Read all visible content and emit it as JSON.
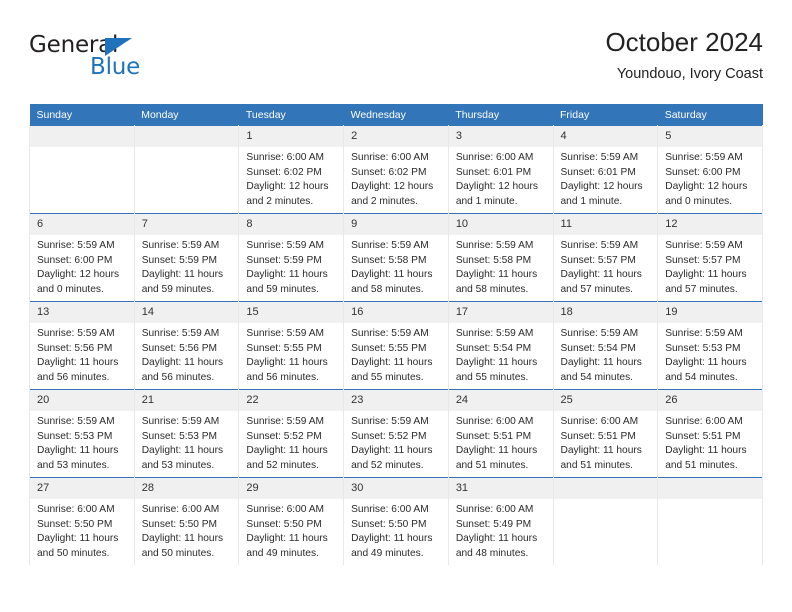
{
  "brand": {
    "name_top": "General",
    "name_bottom": "Blue",
    "triangle_icon": "blue-triangle-icon",
    "color_black": "#231f20",
    "color_blue": "#1f73bd"
  },
  "header": {
    "title": "October 2024",
    "subtitle": "Youndouo, Ivory Coast"
  },
  "theme": {
    "header_blue": "#3275b9",
    "daynum_gray": "#f0f0f0",
    "cell_border": "#e8e8e8"
  },
  "weekday_headers": [
    "Sunday",
    "Monday",
    "Tuesday",
    "Wednesday",
    "Thursday",
    "Friday",
    "Saturday"
  ],
  "weeks": [
    [
      {
        "day": "",
        "empty": true,
        "sunrise": "",
        "sunset": "",
        "daylight_1": "",
        "daylight_2": ""
      },
      {
        "day": "",
        "empty": true,
        "sunrise": "",
        "sunset": "",
        "daylight_1": "",
        "daylight_2": ""
      },
      {
        "day": "1",
        "empty": false,
        "sunrise": "Sunrise: 6:00 AM",
        "sunset": "Sunset: 6:02 PM",
        "daylight_1": "Daylight: 12 hours",
        "daylight_2": "and 2 minutes."
      },
      {
        "day": "2",
        "empty": false,
        "sunrise": "Sunrise: 6:00 AM",
        "sunset": "Sunset: 6:02 PM",
        "daylight_1": "Daylight: 12 hours",
        "daylight_2": "and 2 minutes."
      },
      {
        "day": "3",
        "empty": false,
        "sunrise": "Sunrise: 6:00 AM",
        "sunset": "Sunset: 6:01 PM",
        "daylight_1": "Daylight: 12 hours",
        "daylight_2": "and 1 minute."
      },
      {
        "day": "4",
        "empty": false,
        "sunrise": "Sunrise: 5:59 AM",
        "sunset": "Sunset: 6:01 PM",
        "daylight_1": "Daylight: 12 hours",
        "daylight_2": "and 1 minute."
      },
      {
        "day": "5",
        "empty": false,
        "sunrise": "Sunrise: 5:59 AM",
        "sunset": "Sunset: 6:00 PM",
        "daylight_1": "Daylight: 12 hours",
        "daylight_2": "and 0 minutes."
      }
    ],
    [
      {
        "day": "6",
        "empty": false,
        "sunrise": "Sunrise: 5:59 AM",
        "sunset": "Sunset: 6:00 PM",
        "daylight_1": "Daylight: 12 hours",
        "daylight_2": "and 0 minutes."
      },
      {
        "day": "7",
        "empty": false,
        "sunrise": "Sunrise: 5:59 AM",
        "sunset": "Sunset: 5:59 PM",
        "daylight_1": "Daylight: 11 hours",
        "daylight_2": "and 59 minutes."
      },
      {
        "day": "8",
        "empty": false,
        "sunrise": "Sunrise: 5:59 AM",
        "sunset": "Sunset: 5:59 PM",
        "daylight_1": "Daylight: 11 hours",
        "daylight_2": "and 59 minutes."
      },
      {
        "day": "9",
        "empty": false,
        "sunrise": "Sunrise: 5:59 AM",
        "sunset": "Sunset: 5:58 PM",
        "daylight_1": "Daylight: 11 hours",
        "daylight_2": "and 58 minutes."
      },
      {
        "day": "10",
        "empty": false,
        "sunrise": "Sunrise: 5:59 AM",
        "sunset": "Sunset: 5:58 PM",
        "daylight_1": "Daylight: 11 hours",
        "daylight_2": "and 58 minutes."
      },
      {
        "day": "11",
        "empty": false,
        "sunrise": "Sunrise: 5:59 AM",
        "sunset": "Sunset: 5:57 PM",
        "daylight_1": "Daylight: 11 hours",
        "daylight_2": "and 57 minutes."
      },
      {
        "day": "12",
        "empty": false,
        "sunrise": "Sunrise: 5:59 AM",
        "sunset": "Sunset: 5:57 PM",
        "daylight_1": "Daylight: 11 hours",
        "daylight_2": "and 57 minutes."
      }
    ],
    [
      {
        "day": "13",
        "empty": false,
        "sunrise": "Sunrise: 5:59 AM",
        "sunset": "Sunset: 5:56 PM",
        "daylight_1": "Daylight: 11 hours",
        "daylight_2": "and 56 minutes."
      },
      {
        "day": "14",
        "empty": false,
        "sunrise": "Sunrise: 5:59 AM",
        "sunset": "Sunset: 5:56 PM",
        "daylight_1": "Daylight: 11 hours",
        "daylight_2": "and 56 minutes."
      },
      {
        "day": "15",
        "empty": false,
        "sunrise": "Sunrise: 5:59 AM",
        "sunset": "Sunset: 5:55 PM",
        "daylight_1": "Daylight: 11 hours",
        "daylight_2": "and 56 minutes."
      },
      {
        "day": "16",
        "empty": false,
        "sunrise": "Sunrise: 5:59 AM",
        "sunset": "Sunset: 5:55 PM",
        "daylight_1": "Daylight: 11 hours",
        "daylight_2": "and 55 minutes."
      },
      {
        "day": "17",
        "empty": false,
        "sunrise": "Sunrise: 5:59 AM",
        "sunset": "Sunset: 5:54 PM",
        "daylight_1": "Daylight: 11 hours",
        "daylight_2": "and 55 minutes."
      },
      {
        "day": "18",
        "empty": false,
        "sunrise": "Sunrise: 5:59 AM",
        "sunset": "Sunset: 5:54 PM",
        "daylight_1": "Daylight: 11 hours",
        "daylight_2": "and 54 minutes."
      },
      {
        "day": "19",
        "empty": false,
        "sunrise": "Sunrise: 5:59 AM",
        "sunset": "Sunset: 5:53 PM",
        "daylight_1": "Daylight: 11 hours",
        "daylight_2": "and 54 minutes."
      }
    ],
    [
      {
        "day": "20",
        "empty": false,
        "sunrise": "Sunrise: 5:59 AM",
        "sunset": "Sunset: 5:53 PM",
        "daylight_1": "Daylight: 11 hours",
        "daylight_2": "and 53 minutes."
      },
      {
        "day": "21",
        "empty": false,
        "sunrise": "Sunrise: 5:59 AM",
        "sunset": "Sunset: 5:53 PM",
        "daylight_1": "Daylight: 11 hours",
        "daylight_2": "and 53 minutes."
      },
      {
        "day": "22",
        "empty": false,
        "sunrise": "Sunrise: 5:59 AM",
        "sunset": "Sunset: 5:52 PM",
        "daylight_1": "Daylight: 11 hours",
        "daylight_2": "and 52 minutes."
      },
      {
        "day": "23",
        "empty": false,
        "sunrise": "Sunrise: 5:59 AM",
        "sunset": "Sunset: 5:52 PM",
        "daylight_1": "Daylight: 11 hours",
        "daylight_2": "and 52 minutes."
      },
      {
        "day": "24",
        "empty": false,
        "sunrise": "Sunrise: 6:00 AM",
        "sunset": "Sunset: 5:51 PM",
        "daylight_1": "Daylight: 11 hours",
        "daylight_2": "and 51 minutes."
      },
      {
        "day": "25",
        "empty": false,
        "sunrise": "Sunrise: 6:00 AM",
        "sunset": "Sunset: 5:51 PM",
        "daylight_1": "Daylight: 11 hours",
        "daylight_2": "and 51 minutes."
      },
      {
        "day": "26",
        "empty": false,
        "sunrise": "Sunrise: 6:00 AM",
        "sunset": "Sunset: 5:51 PM",
        "daylight_1": "Daylight: 11 hours",
        "daylight_2": "and 51 minutes."
      }
    ],
    [
      {
        "day": "27",
        "empty": false,
        "sunrise": "Sunrise: 6:00 AM",
        "sunset": "Sunset: 5:50 PM",
        "daylight_1": "Daylight: 11 hours",
        "daylight_2": "and 50 minutes."
      },
      {
        "day": "28",
        "empty": false,
        "sunrise": "Sunrise: 6:00 AM",
        "sunset": "Sunset: 5:50 PM",
        "daylight_1": "Daylight: 11 hours",
        "daylight_2": "and 50 minutes."
      },
      {
        "day": "29",
        "empty": false,
        "sunrise": "Sunrise: 6:00 AM",
        "sunset": "Sunset: 5:50 PM",
        "daylight_1": "Daylight: 11 hours",
        "daylight_2": "and 49 minutes."
      },
      {
        "day": "30",
        "empty": false,
        "sunrise": "Sunrise: 6:00 AM",
        "sunset": "Sunset: 5:50 PM",
        "daylight_1": "Daylight: 11 hours",
        "daylight_2": "and 49 minutes."
      },
      {
        "day": "31",
        "empty": false,
        "sunrise": "Sunrise: 6:00 AM",
        "sunset": "Sunset: 5:49 PM",
        "daylight_1": "Daylight: 11 hours",
        "daylight_2": "and 48 minutes."
      },
      {
        "day": "",
        "empty": true,
        "sunrise": "",
        "sunset": "",
        "daylight_1": "",
        "daylight_2": ""
      },
      {
        "day": "",
        "empty": true,
        "sunrise": "",
        "sunset": "",
        "daylight_1": "",
        "daylight_2": ""
      }
    ]
  ]
}
